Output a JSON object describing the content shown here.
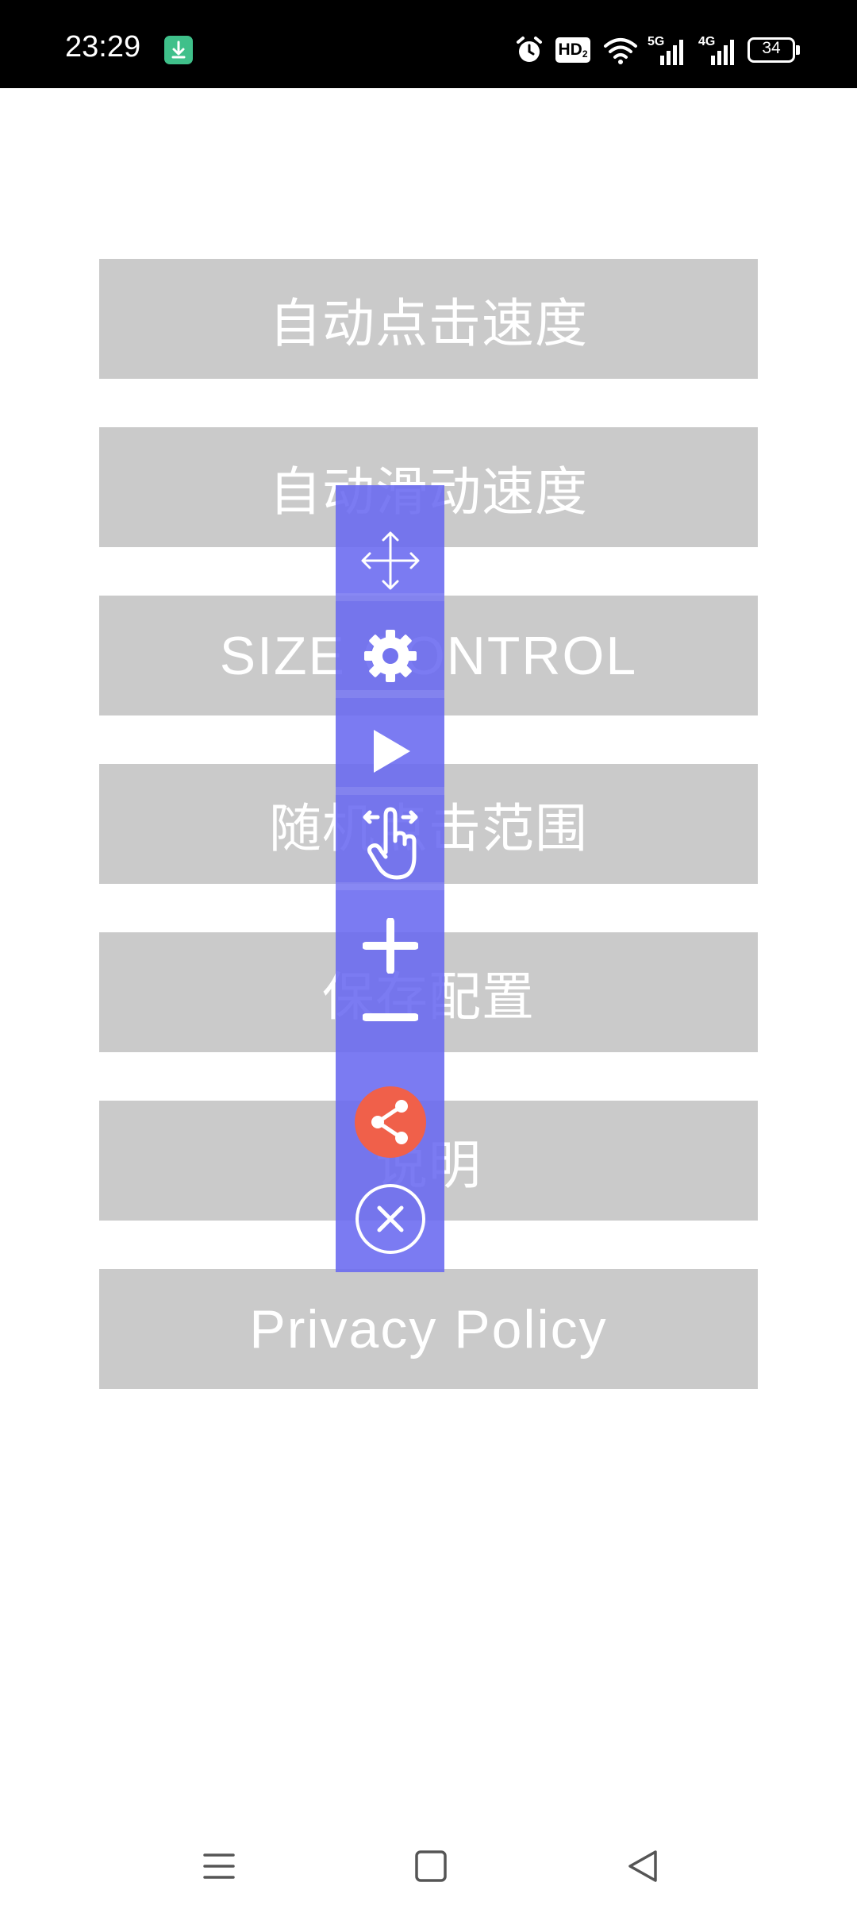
{
  "status_bar": {
    "time": "23:29",
    "icons": [
      "download-icon",
      "alarm-icon",
      "hd-icon",
      "wifi-icon",
      "5g-signal-icon",
      "4g-signal-icon",
      "battery-icon"
    ],
    "hd_label": "HD",
    "hd_sub": "2",
    "net_5g": "5G",
    "net_4g": "4G",
    "battery_level": "34"
  },
  "menu": {
    "items": [
      {
        "label": "自动点击速度"
      },
      {
        "label": "自动滑动速度"
      },
      {
        "label": "SIZE CONTROL"
      },
      {
        "label": "随机点击范围"
      },
      {
        "label": "保存配置"
      },
      {
        "label": "说明"
      },
      {
        "label": "Privacy Policy"
      }
    ]
  },
  "floating_toolbar": {
    "background": "#6a6af0",
    "accent": "#f0604a",
    "icons": [
      "move-icon",
      "gear-icon",
      "play-icon",
      "tap-gesture-icon",
      "plus-icon",
      "minus-icon",
      "share-icon",
      "close-icon"
    ]
  },
  "nav_bar": {
    "icons": [
      "menu-icon",
      "home-icon",
      "back-icon"
    ]
  }
}
